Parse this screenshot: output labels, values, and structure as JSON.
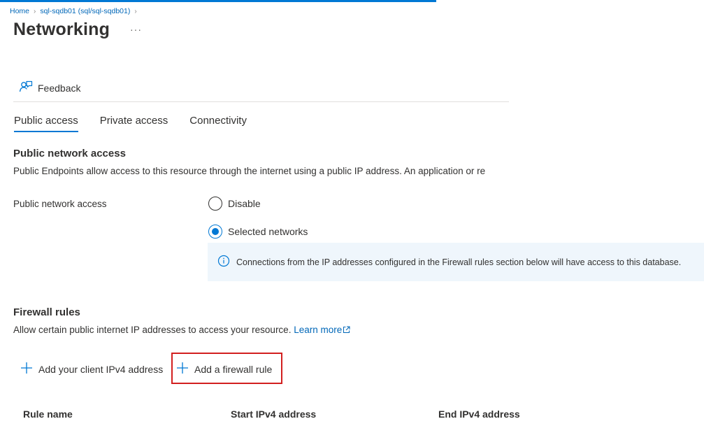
{
  "breadcrumb": {
    "home": "Home",
    "resource": "sql-sqdb01 (sql/sql-sqdb01)"
  },
  "page": {
    "title": "Networking",
    "more": "···"
  },
  "toolbar": {
    "feedback_label": "Feedback"
  },
  "tabs": [
    {
      "label": "Public access",
      "active": true
    },
    {
      "label": "Private access",
      "active": false
    },
    {
      "label": "Connectivity",
      "active": false
    }
  ],
  "public_network": {
    "heading": "Public network access",
    "description": "Public Endpoints allow access to this resource through the internet using a public IP address. An application or re",
    "field_label": "Public network access",
    "options": [
      {
        "label": "Disable",
        "checked": false
      },
      {
        "label": "Selected networks",
        "checked": true
      }
    ],
    "info_text": "Connections from the IP addresses configured in the Firewall rules section below will have access to this database."
  },
  "firewall": {
    "heading": "Firewall rules",
    "description": "Allow certain public internet IP addresses to access your resource.",
    "learn_more": "Learn more",
    "add_client_ip_label": "Add your client IPv4 address",
    "add_rule_label": "Add a firewall rule",
    "columns": [
      "Rule name",
      "Start IPv4 address",
      "End IPv4 address"
    ]
  },
  "colors": {
    "accent": "#0078d4",
    "link": "#0067b8",
    "highlight": "#d21f1f",
    "info_bg": "#eff6fc"
  }
}
